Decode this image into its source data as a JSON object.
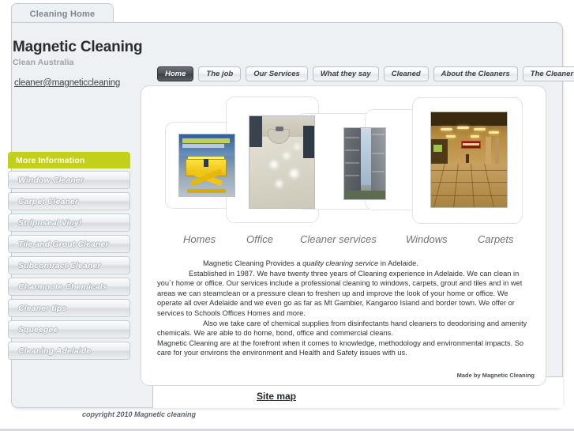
{
  "browser_tab": {
    "label": "Cleaning Home"
  },
  "brand": {
    "title": "Magnetic Cleaning",
    "subtitle": "Clean Australia",
    "email": "cleaner@magneticcleaning"
  },
  "nav": {
    "items": [
      {
        "label": "Home",
        "active": true
      },
      {
        "label": "The  job",
        "active": false
      },
      {
        "label": "Our Services",
        "active": false
      },
      {
        "label": "What they say",
        "active": false
      },
      {
        "label": "Cleaned",
        "active": false
      },
      {
        "label": "About the Cleaners",
        "active": false
      },
      {
        "label": "The Cleaner",
        "active": false
      }
    ]
  },
  "sidebar": {
    "heading": "More Information",
    "heading_color": "#c2d01a",
    "items": [
      {
        "label": "Window Cleaner"
      },
      {
        "label": "Carpet Cleaner"
      },
      {
        "label": "Stripnseal Vinyl"
      },
      {
        "label": "Tile and Grout Cleaner"
      },
      {
        "label": "Subcontract Cleaner"
      },
      {
        "label": "Charmnote Chemicals"
      },
      {
        "label": "Cleaner tips"
      },
      {
        "label": "Squeegee"
      },
      {
        "label": "Cleaning Adelaide"
      }
    ]
  },
  "gallery": {
    "captions": [
      {
        "label": "Homes"
      },
      {
        "label": "Office"
      },
      {
        "label": "Cleaner  services"
      },
      {
        "label": "Windows"
      },
      {
        "label": "Carpets"
      }
    ],
    "photos": [
      {
        "alt": "yellow-scissor-lift-photo"
      },
      {
        "alt": "polished-glossy-floor-photo"
      },
      {
        "alt": "high-rise-buildings-photo"
      },
      {
        "alt": "warm-lit-mall-interior-photo"
      }
    ]
  },
  "body": {
    "lead_before": "Magnetic Cleaning Provides a ",
    "lead_em": "quality cleaning service",
    "lead_after": " in Adelaide.",
    "para1": "Established in 1987. We have twenty three years of Cleaning experience in Adelaide. We can clean in you`r home or office. Our services include a professional cleaning to windows, carpets, grout and tiles and in wet areas we can steamclean or a  pressure clean to freshen up and improve the look of your home or office. We operate all over Adelaide and we even go as far as Mt Gambier, Kangaroo Island and border town. We offer or services to Schools Offices Homes and more.",
    "para2": "Also we  take care of chemical supplies from disinfectants hand cleaners to deodorising and amenity chemicals.  We are able to do home, bond, office and commercial cleans.",
    "para3": "Magnetic Cleaning are at the forefront when it comes to  knowledge, methodology and environmental impacts. So care for your environs the environment and Health and Safety issues with us.",
    "made_by": "Made by Magnetic Cleaning"
  },
  "footer": {
    "sitemap": "Site map",
    "copyright": "copyright 2010 Magnetic cleaning"
  }
}
